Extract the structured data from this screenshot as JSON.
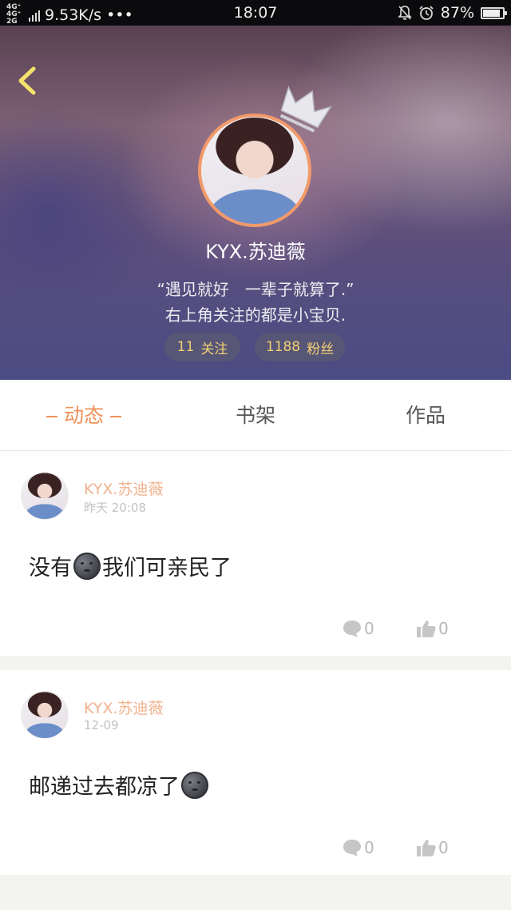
{
  "status_bar": {
    "network_1": "4G⁺",
    "network_2": "4G⁺ 2G",
    "speed": "9.53K/s",
    "dots": "•••",
    "time": "18:07",
    "battery_percent": "87%",
    "battery_level": 0.87
  },
  "profile": {
    "username": "KYX.苏迪薇",
    "bio_line1": "“遇见就好　一辈子就算了.”",
    "bio_line2": "右上角关注的都是小宝贝.",
    "following_count": "11",
    "following_label": "关注",
    "fans_count": "1188",
    "fans_label": "粉丝"
  },
  "tabs": [
    {
      "label": "动态",
      "active": true
    },
    {
      "label": "书架",
      "active": false
    },
    {
      "label": "作品",
      "active": false
    }
  ],
  "posts": [
    {
      "author": "KYX.苏迪薇",
      "time": "昨天 20:08",
      "text_before": "没有",
      "emoji": "new-moon-face",
      "text_after": "我们可亲民了",
      "comments": "0",
      "likes": "0"
    },
    {
      "author": "KYX.苏迪薇",
      "time": "12-09",
      "text_before": "邮递过去都凉了",
      "emoji": "new-moon-face",
      "text_after": "",
      "comments": "0",
      "likes": "0"
    }
  ],
  "colors": {
    "accent": "#f0915a",
    "name_orange": "#f0b28f",
    "pill_text": "#f2cf73",
    "back_arrow": "#f3e36a"
  }
}
